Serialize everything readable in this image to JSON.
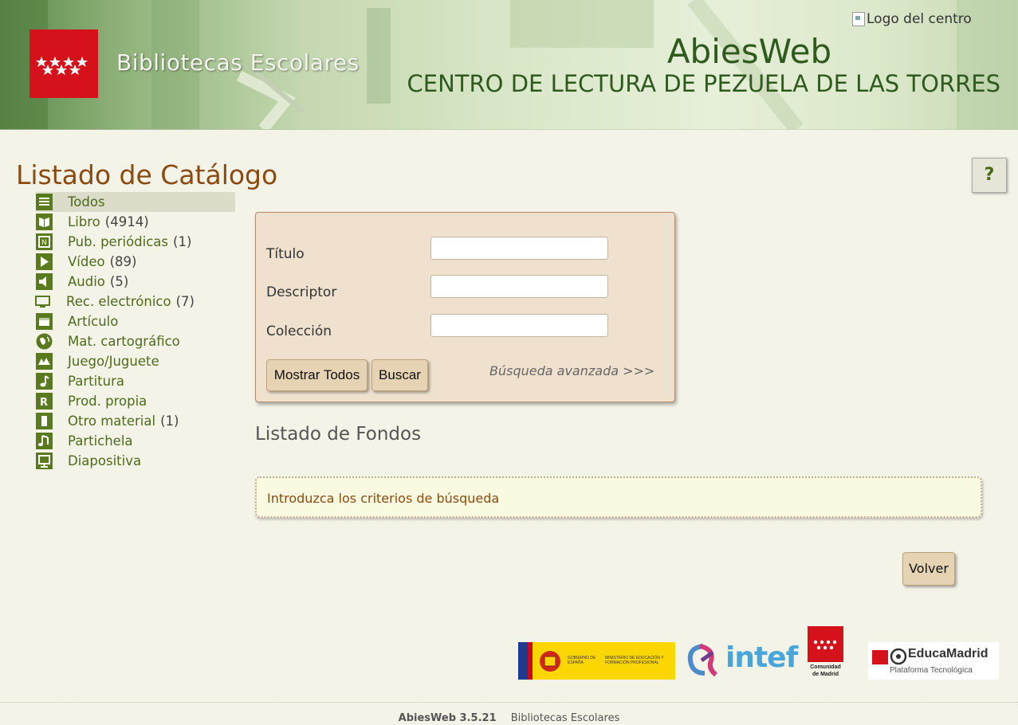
{
  "header": {
    "brand": "Bibliotecas Escolares",
    "app_name": "AbiesWeb",
    "center_name": "CENTRO DE LECTURA DE PEZUELA DE LAS TORRES",
    "center_logo_alt": "Logo del centro"
  },
  "page": {
    "title": "Listado de Catálogo",
    "help_label": "?"
  },
  "sidebar": {
    "items": [
      {
        "label": "Todos",
        "count": "",
        "icon": "stack-icon",
        "active": true
      },
      {
        "label": "Libro",
        "count": "(4914)",
        "icon": "book-icon"
      },
      {
        "label": "Pub. periódicas",
        "count": "(1)",
        "icon": "newspaper-icon"
      },
      {
        "label": "Vídeo",
        "count": "(89)",
        "icon": "play-icon"
      },
      {
        "label": "Audio",
        "count": "(5)",
        "icon": "speaker-icon"
      },
      {
        "label": "Rec. electrónico",
        "count": "(7)",
        "icon": "monitor-icon"
      },
      {
        "label": "Artículo",
        "count": "",
        "icon": "article-icon"
      },
      {
        "label": "Mat. cartográfico",
        "count": "",
        "icon": "globe-icon"
      },
      {
        "label": "Juego/Juguete",
        "count": "",
        "icon": "game-icon"
      },
      {
        "label": "Partitura",
        "count": "",
        "icon": "music-note-icon"
      },
      {
        "label": "Prod. propia",
        "count": "",
        "icon": "r-letter-icon"
      },
      {
        "label": "Otro material",
        "count": "(1)",
        "icon": "box-icon"
      },
      {
        "label": "Partichela",
        "count": "",
        "icon": "notes-icon"
      },
      {
        "label": "Diapositiva",
        "count": "",
        "icon": "slide-icon"
      }
    ]
  },
  "search": {
    "titulo_label": "Título",
    "titulo_value": "",
    "descriptor_label": "Descriptor",
    "descriptor_value": "",
    "coleccion_label": "Colección",
    "coleccion_value": "",
    "show_all_label": "Mostrar Todos",
    "search_label": "Buscar",
    "advanced_label": "Búsqueda avanzada >>>"
  },
  "results": {
    "title": "Listado de Fondos",
    "notice": "Introduzca los criterios de búsqueda",
    "back_label": "Volver"
  },
  "partners": {
    "gob_text_1": "GOBIERNO DE ESPAÑA",
    "gob_text_2": "MINISTERIO DE EDUCACIÓN Y FORMACIÓN PROFESIONAL",
    "intef": "intef",
    "cm_text": "Comunidad de Madrid",
    "educa": "EducaMadrid",
    "educa_sub": "Plataforma Tecnológica"
  },
  "footer": {
    "version": "AbiesWeb 3.5.21",
    "text": "Bibliotecas Escolares"
  },
  "colors": {
    "accent_green": "#4f6a1a",
    "title_brown": "#8b4a0f",
    "cm_red": "#d5121b"
  }
}
